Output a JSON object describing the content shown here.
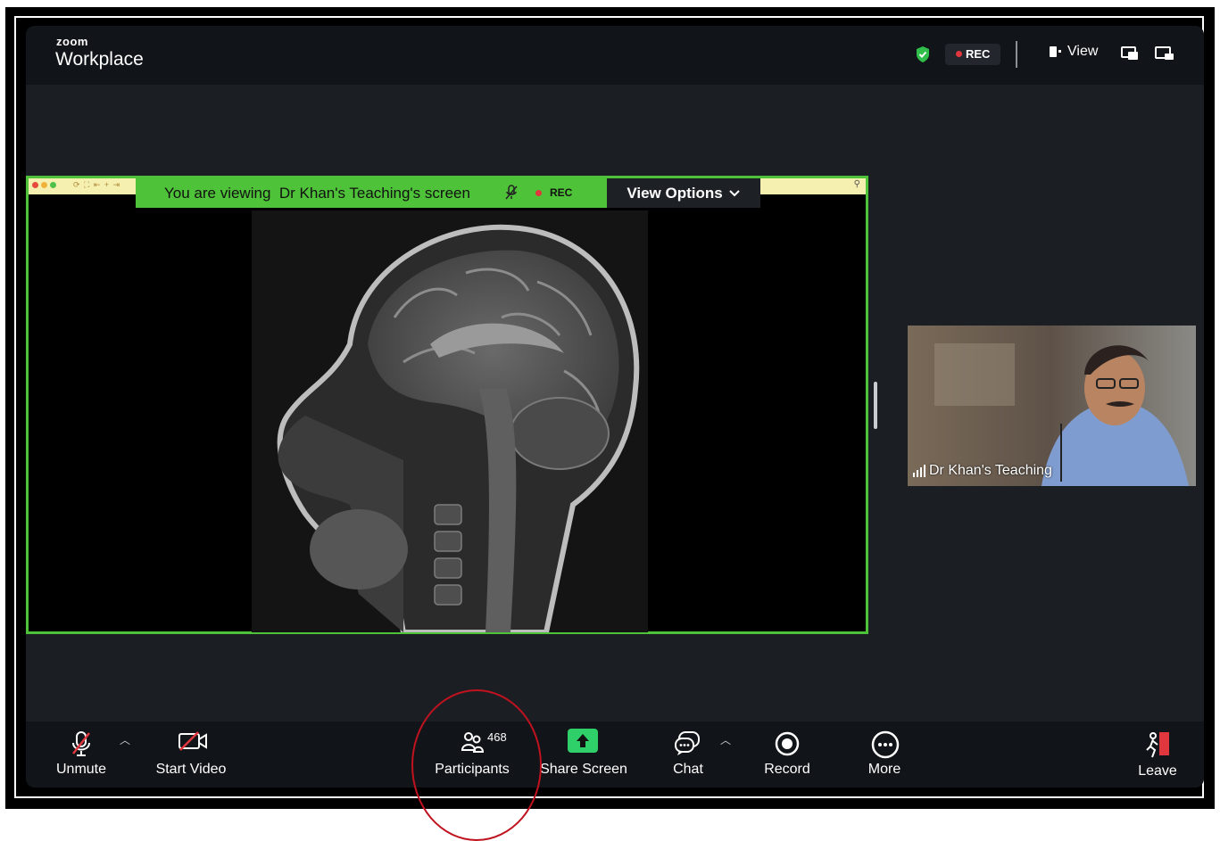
{
  "app": {
    "brand_small": "zoom",
    "brand_title": "Workplace"
  },
  "topbar": {
    "security_icon": "shield-check-icon",
    "rec_label": "REC",
    "view_label": "View",
    "icons": [
      "view-layout-icon",
      "picture-in-picture-icon",
      "minimize-icon"
    ]
  },
  "share": {
    "banner_prefix": "You are viewing",
    "banner_name": "Dr Khan's Teaching's screen",
    "banner_rec": "REC",
    "view_options_label": "View Options",
    "content": "sagittal brain MRI image"
  },
  "participant_tile": {
    "name": "Dr Khan's Teaching"
  },
  "toolbar": {
    "unmute": "Unmute",
    "start_video": "Start Video",
    "participants": "Participants",
    "participants_count": "468",
    "share_screen": "Share Screen",
    "chat": "Chat",
    "record": "Record",
    "more": "More",
    "leave": "Leave"
  },
  "colors": {
    "accent_green": "#4ec238",
    "share_green": "#2fcf6a",
    "rec_red": "#e0363e",
    "annotation_red": "#c0121f",
    "app_bg": "#1b1f24"
  }
}
